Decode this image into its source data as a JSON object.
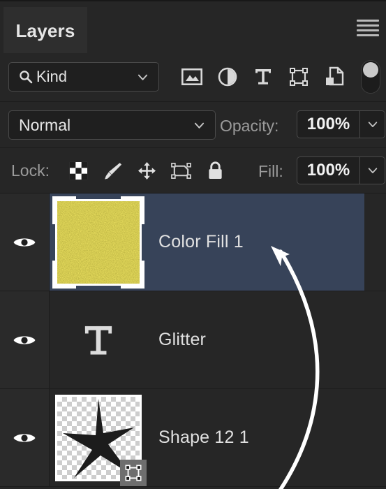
{
  "panel": {
    "tab_label": "Layers",
    "menu_icon": "hamburger-menu-icon"
  },
  "filter": {
    "kind_label": "Kind",
    "search_icon": "search-icon",
    "chevron_icon": "chevron-down-icon",
    "type_filters": [
      {
        "name": "filter-pixel-layers",
        "icon": "image-icon"
      },
      {
        "name": "filter-adjustment-layers",
        "icon": "half-circle-adjustment-icon"
      },
      {
        "name": "filter-type-layers",
        "icon": "type-t-icon"
      },
      {
        "name": "filter-shape-layers",
        "icon": "vector-shape-icon"
      },
      {
        "name": "filter-smart-objects",
        "icon": "smart-object-document-icon"
      }
    ],
    "toggle": {
      "name": "filter-enable-toggle",
      "state": "off"
    }
  },
  "blend": {
    "mode": "Normal",
    "opacity_label": "Opacity:",
    "opacity_value": "100%"
  },
  "lock": {
    "label": "Lock:",
    "buttons": [
      {
        "name": "lock-transparent-pixels",
        "icon": "checkerboard-icon"
      },
      {
        "name": "lock-image-pixels",
        "icon": "brush-icon"
      },
      {
        "name": "lock-position",
        "icon": "move-arrows-icon"
      },
      {
        "name": "prevent-auto-nesting",
        "icon": "artboard-icon"
      },
      {
        "name": "lock-all",
        "icon": "lock-icon"
      }
    ],
    "fill_label": "Fill:",
    "fill_value": "100%"
  },
  "layers": [
    {
      "name": "Color Fill 1",
      "selected": true,
      "visible": true,
      "thumb_type": "glitter",
      "thumb_color": "#ada024",
      "has_selection_brackets": true,
      "badge": null
    },
    {
      "name": "Glitter",
      "selected": false,
      "visible": true,
      "thumb_type": "type",
      "thumb_color": null,
      "has_selection_brackets": false,
      "badge": null
    },
    {
      "name": "Shape 12 1",
      "selected": false,
      "visible": true,
      "thumb_type": "shape-star",
      "thumb_color": "#1c1c1c",
      "has_selection_brackets": false,
      "badge": "vector-shape-badge-icon"
    }
  ],
  "annotation": {
    "type": "curved-arrow",
    "color": "#ffffff",
    "points_to": "Color Fill 1"
  },
  "colors": {
    "panel_bg": "#262626",
    "selection_blue": "#374359",
    "text": "#e0e0e0",
    "muted_text": "#9b9b9b",
    "divider": "#1c1c1c"
  }
}
